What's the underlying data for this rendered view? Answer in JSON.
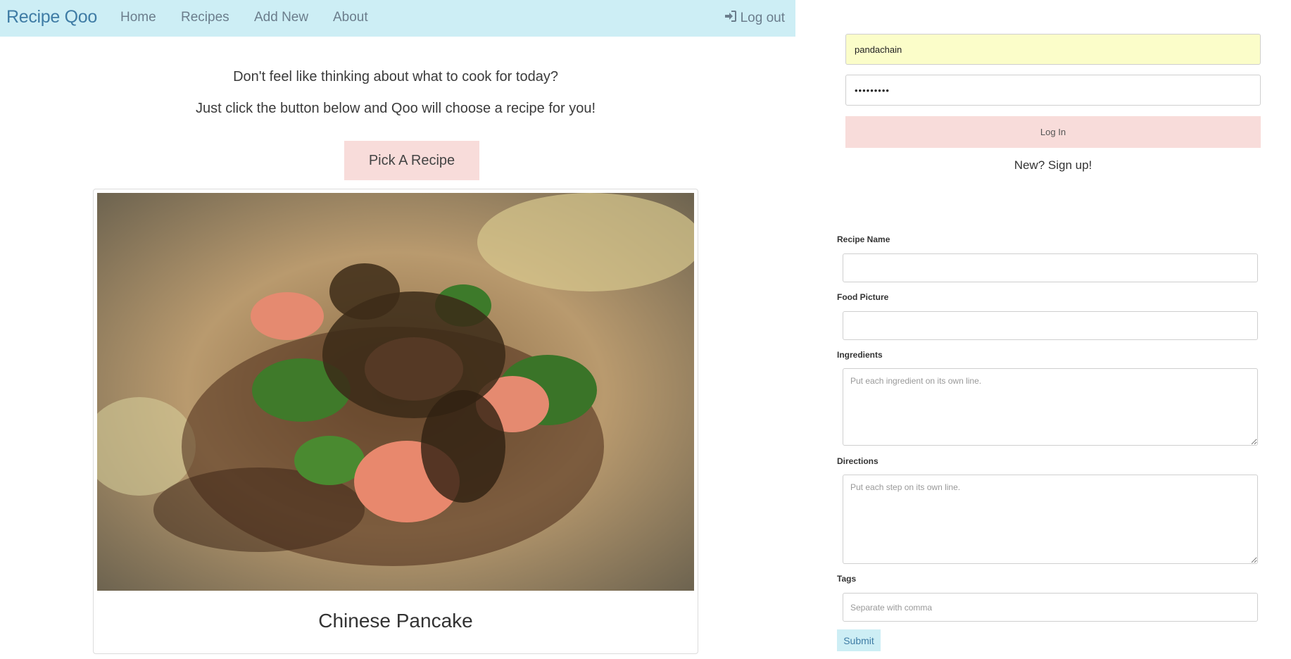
{
  "navbar": {
    "brand": "Recipe Qoo",
    "links": [
      "Home",
      "Recipes",
      "Add New",
      "About"
    ],
    "logout_label": "Log out"
  },
  "main": {
    "prompt_line_1": "Don't feel like thinking about what to cook for today?",
    "prompt_line_2": "Just click the button below and Qoo will choose a recipe for you!",
    "pick_button_label": "Pick A Recipe",
    "recipe_card": {
      "title": "Chinese Pancake"
    }
  },
  "login": {
    "username_value": "pandachain",
    "password_value": "•••••••••",
    "login_button_label": "Log In",
    "signup_link": "New? Sign up!"
  },
  "add_recipe_form": {
    "recipe_name_label": "Recipe Name",
    "food_picture_label": "Food Picture",
    "ingredients_label": "Ingredients",
    "ingredients_placeholder": "Put each ingredient on its own line.",
    "directions_label": "Directions",
    "directions_placeholder": "Put each step on its own line.",
    "tags_label": "Tags",
    "tags_placeholder": "Separate with comma",
    "submit_label": "Submit"
  },
  "colors": {
    "navbar_bg": "#cdeef5",
    "brand": "#3f7ca5",
    "pink_button": "#f8dcda",
    "autofill_yellow": "#fbfdc9"
  }
}
